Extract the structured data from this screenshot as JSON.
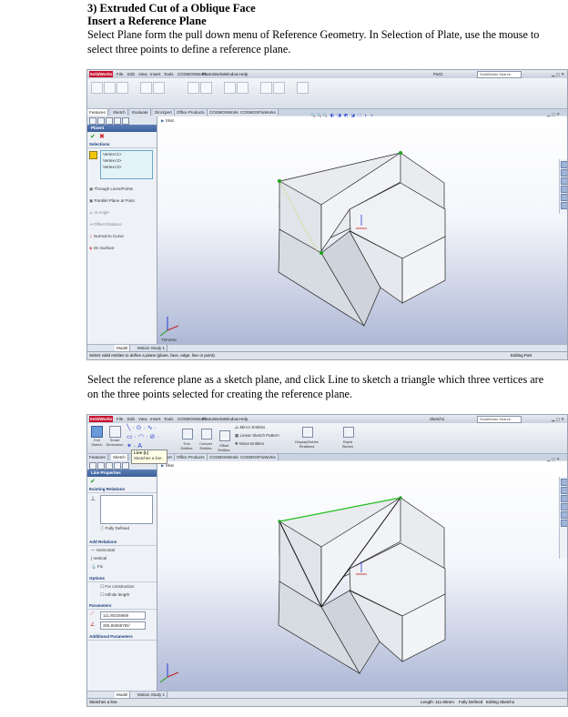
{
  "doc": {
    "heading1": "3) Extruded Cut of a Oblique Face",
    "heading2": "Insert a Reference Plane",
    "para1": "Select Plane form the pull down menu of Reference Geometry. In Selection of Plate, use the mouse to select three points to define a reference plane.",
    "para2": "Select the reference plane as a sketch plane, and click Line to sketch a triangle which three vertices are on the three points selected for creating the reference plane."
  },
  "app": {
    "logo": "SolidWorks",
    "menu": [
      "File",
      "Edit",
      "View",
      "Insert",
      "Tools",
      "COSMOSWorks",
      "PhotoWorks",
      "Window",
      "Help"
    ],
    "search_placeholder": "SolidWorks Search",
    "doc_name_1": "Part1",
    "doc_name_2": "Sketch1",
    "search_placeholder_2": "SolidWorks Search"
  },
  "shot1": {
    "tabs": [
      "Features",
      "Sketch",
      "Evaluate",
      "DimXpert",
      "Office Products",
      "COSMOSWorks",
      "COSMOSFloWorks"
    ],
    "panel_title": "Plane1",
    "selections_label": "Selections",
    "vertices": [
      "Vertex<1>",
      "Vertex<2>",
      "Vertex<3>"
    ],
    "options": [
      "Through Lines/Points",
      "Parallel Plane at Point",
      "At Angle",
      "Offset Distance",
      "Normal to Curve",
      "On Surface"
    ],
    "tree_root": "Skat",
    "view_label": "Trimetric",
    "bottom_tabs": [
      "Model",
      "Motion Study 1"
    ],
    "status_text": "Select valid entities to define a plane (plane, face, edge, line or point).",
    "status_right": "Editing Part"
  },
  "shot2": {
    "ribbon_left": [
      "Exit Sketch",
      "Smart Dimension"
    ],
    "ribbon_mid": [
      "Trim Entities",
      "Convert Entities",
      "Offset Entities"
    ],
    "ribbon_right": [
      "Mirror Entities",
      "Linear Sketch Pattern",
      "Move Entities"
    ],
    "ribbon_far": [
      "Display/Delete Relations",
      "Repair Sketch",
      "Rapid Sketch"
    ],
    "tooltip_title": "Line (L)",
    "tooltip_body": "Sketches a line.",
    "tabs": [
      "Features",
      "Sketch",
      "Evaluate",
      "DimXpert",
      "Office Products",
      "COSMOSWorks",
      "COSMOSFloWorks"
    ],
    "panel_title": "Line Properties",
    "existing_relations": "Existing Relations",
    "fully_defined": "Fully Defined",
    "add_relations": "Add Relations",
    "relations": [
      "Horizontal",
      "Vertical",
      "Fix"
    ],
    "options_label": "Options",
    "option_items": [
      "For construction",
      "Infinite length"
    ],
    "parameters_label": "Parameters",
    "param_values": [
      "111.80339888",
      "306.86989765°"
    ],
    "additional_params": "Additional Parameters",
    "tree_root": "Skat",
    "bottom_tabs": [
      "Model",
      "Motion Study 1"
    ],
    "status_text": "Sketches a line.",
    "status_length": "Length: 111.80mm",
    "status_defined": "Fully Defined",
    "status_editing": "Editing Sketch1"
  },
  "colors": {
    "sketch_line": "#22c322",
    "selected_point": "#1ea01e",
    "axis_blue": "#2a3bd6",
    "panel_header": "#4a6daa"
  }
}
